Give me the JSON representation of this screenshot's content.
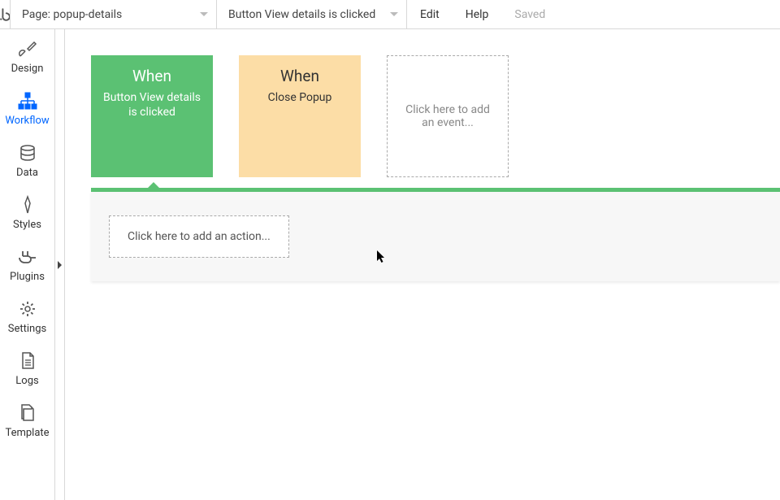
{
  "topbar": {
    "page_dropdown": "Page: popup-details",
    "event_dropdown": "Button View details is clicked",
    "edit": "Edit",
    "help": "Help",
    "saved": "Saved"
  },
  "sidebar": {
    "items": [
      {
        "label": "Design"
      },
      {
        "label": "Workflow"
      },
      {
        "label": "Data"
      },
      {
        "label": "Styles"
      },
      {
        "label": "Plugins"
      },
      {
        "label": "Settings"
      },
      {
        "label": "Logs"
      },
      {
        "label": "Template"
      }
    ]
  },
  "workflow": {
    "events": [
      {
        "when": "When",
        "desc": "Button View details is clicked"
      },
      {
        "when": "When",
        "desc": "Close Popup"
      }
    ],
    "add_event": "Click here to add an event...",
    "add_action": "Click here to add an action..."
  }
}
